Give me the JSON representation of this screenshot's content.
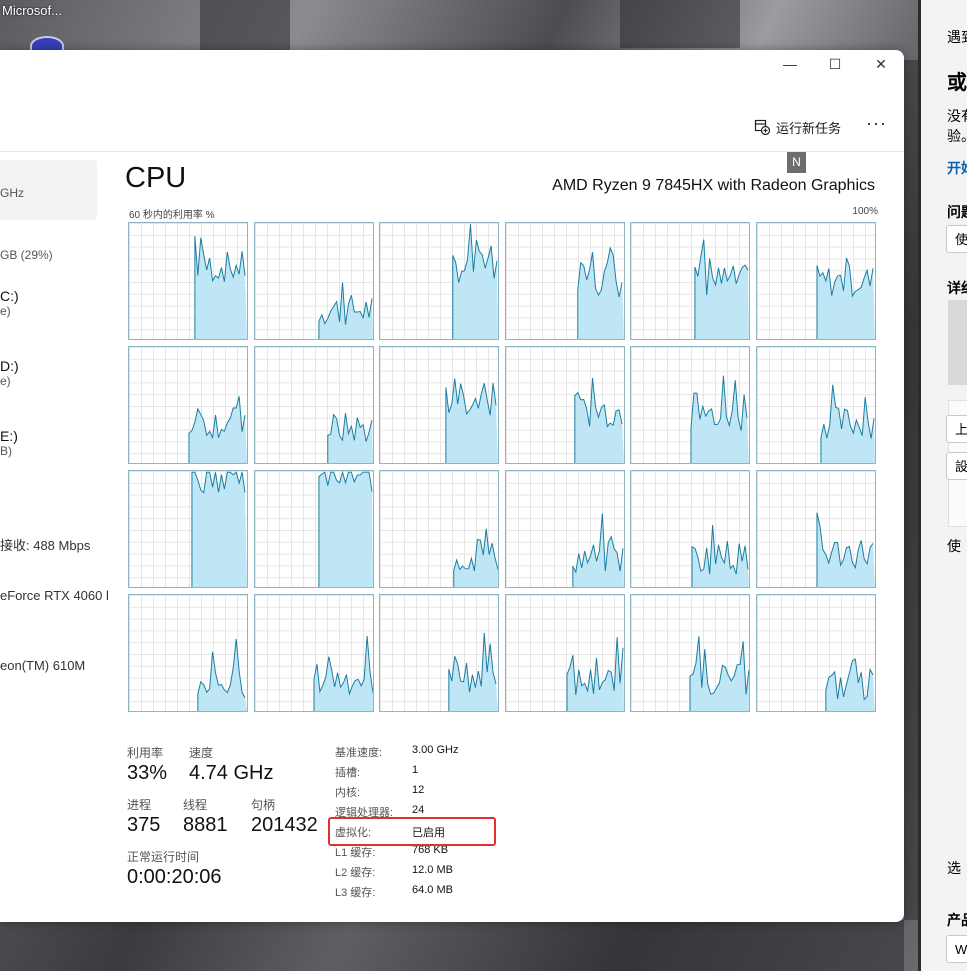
{
  "desktop": {
    "icon_label": "Microsof..."
  },
  "window": {
    "controls": {
      "minimize": "—",
      "maximize": "☐",
      "close": "✕"
    },
    "toolbar": {
      "run_new_task": "运行新任务",
      "more": "···"
    },
    "tooltip": "N"
  },
  "nav": {
    "items": [
      {
        "main": "",
        "sub": "GHz"
      },
      {
        "main": "",
        "sub": "GB (29%)"
      },
      {
        "main": "C:)",
        "sub": "e)"
      },
      {
        "main": "D:)",
        "sub": "e)"
      },
      {
        "main": "E:)",
        "sub": "B)"
      },
      {
        "main": "",
        "sub": "接收: 488 Mbps"
      },
      {
        "main": "",
        "sub": "eForce RTX 4060 l"
      },
      {
        "main": "",
        "sub": "eon(TM) 610M"
      }
    ]
  },
  "cpu": {
    "title": "CPU",
    "model": "AMD Ryzen 9 7845HX with Radeon Graphics",
    "graph_label": "60 秒内的利用率 %",
    "graph_max": "100%",
    "logical_processors_graphs": 24
  },
  "stats": {
    "utilization": {
      "label": "利用率",
      "value": "33%"
    },
    "speed": {
      "label": "速度",
      "value": "4.74 GHz"
    },
    "processes": {
      "label": "进程",
      "value": "375"
    },
    "threads": {
      "label": "线程",
      "value": "8881"
    },
    "handles": {
      "label": "句柄",
      "value": "201432"
    },
    "uptime": {
      "label": "正常运行时间",
      "value": "0:00:20:06"
    }
  },
  "specs": [
    {
      "key": "基准速度:",
      "value": "3.00 GHz"
    },
    {
      "key": "插槽:",
      "value": "1"
    },
    {
      "key": "内核:",
      "value": "12"
    },
    {
      "key": "逻辑处理器:",
      "value": "24"
    },
    {
      "key": "虚拟化:",
      "value": "已启用"
    },
    {
      "key": "L1 缓存:",
      "value": "768 KB"
    },
    {
      "key": "L2 缓存:",
      "value": "12.0 MB"
    },
    {
      "key": "L3 缓存:",
      "value": "64.0 MB"
    }
  ],
  "side_panel": {
    "line1": "遇到",
    "heading": "或",
    "line2": "没有",
    "line3": "验。",
    "link": "开始",
    "label_issue": "问题",
    "box1": "使",
    "label_detail": "详细",
    "btn1": "上",
    "btn2": "設",
    "label_use": "使",
    "label_selected": "选",
    "label_product": "产品",
    "box2": "W"
  },
  "colors": {
    "graph_line": "#1a7ca0",
    "graph_fill": "#bfe6f5",
    "highlight_box": "#e03030"
  }
}
